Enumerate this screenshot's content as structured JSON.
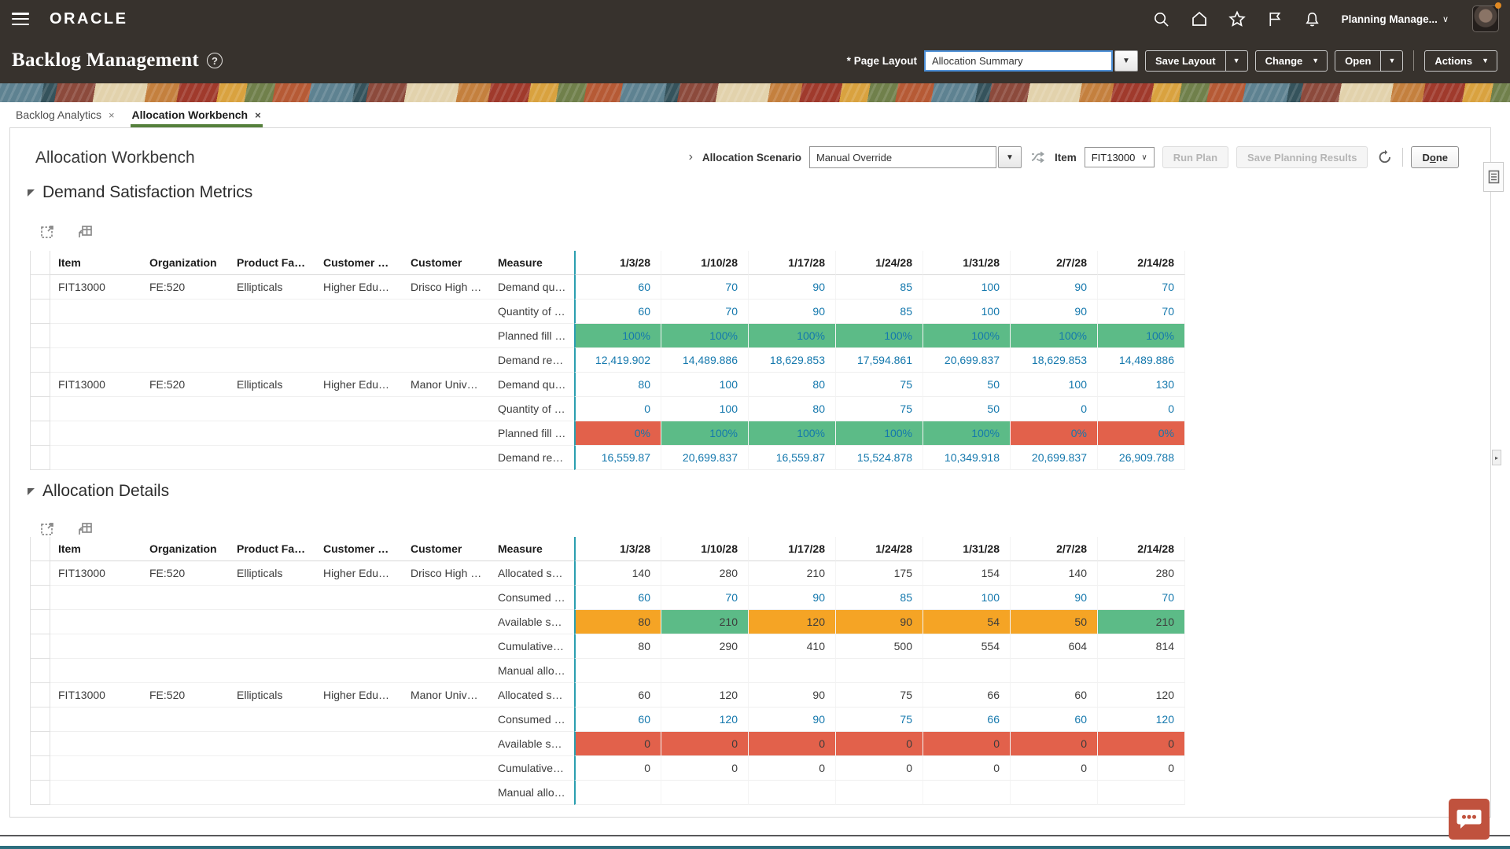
{
  "glyphs": {
    "caret_down": "▼",
    "chevron_down": "∨",
    "close": "×",
    "help": "?",
    "back_chevron": "›",
    "splitter_arrow": "▸"
  },
  "colors": {
    "header_bg": "#37322D",
    "link": "#1478AD",
    "green_cell": "#5CBB87",
    "red_cell": "#E2614B",
    "orange_cell": "#F5A425",
    "tab_underline": "#55803C",
    "measure_divider": "#2B9FB0",
    "chat_button": "#C0523E"
  },
  "topbar": {
    "brand": "ORACLE",
    "user_menu": "Planning Manage..."
  },
  "page_header": {
    "required_marker": "*",
    "page_layout_label": "Page Layout",
    "page_layout_value": "Allocation Summary",
    "title": "Backlog Management",
    "buttons": {
      "save_layout": "Save Layout",
      "change": "Change",
      "open": "Open",
      "actions": "Actions"
    }
  },
  "tabs": [
    {
      "label": "Backlog Analytics",
      "active": false
    },
    {
      "label": "Allocation Workbench",
      "active": true
    }
  ],
  "workbench": {
    "title": "Allocation Workbench",
    "scenario_label": "Allocation Scenario",
    "scenario_value": "Manual Override",
    "item_label": "Item",
    "item_value": "FIT13000",
    "run_plan": "Run Plan",
    "save_planning_results": "Save Planning Results",
    "done_prefix": "D",
    "done_accesskey": "o",
    "done_suffix": "ne"
  },
  "table": {
    "columns": [
      "Item",
      "Organization",
      "Product Family",
      "Customer Class",
      "Customer",
      "Measure"
    ],
    "dates": [
      "1/3/28",
      "1/10/28",
      "1/17/28",
      "1/24/28",
      "1/31/28",
      "2/7/28",
      "2/14/28"
    ]
  },
  "sections": [
    {
      "title": "Demand Satisfaction Metrics",
      "rows": [
        {
          "item": "FIT13000",
          "organization": "FE:520",
          "product_family": "Ellipticals",
          "customer_class": "Higher Education",
          "customer": "Drisco High Sch...",
          "measure": "Demand quantity",
          "value_style": "link",
          "values": [
            "60",
            "70",
            "90",
            "85",
            "100",
            "90",
            "70"
          ]
        },
        {
          "measure": "Quantity of dem...",
          "value_style": "link",
          "values": [
            "60",
            "70",
            "90",
            "85",
            "100",
            "90",
            "70"
          ]
        },
        {
          "measure": "Planned fill rate ...",
          "value_style": "link",
          "values": [
            "100%",
            "100%",
            "100%",
            "100%",
            "100%",
            "100%",
            "100%"
          ],
          "cell_bg": [
            "green",
            "green",
            "green",
            "green",
            "green",
            "green",
            "green"
          ]
        },
        {
          "measure": "Demand revenue",
          "value_style": "link",
          "values": [
            "12,419.902",
            "14,489.886",
            "18,629.853",
            "17,594.861",
            "20,699.837",
            "18,629.853",
            "14,489.886"
          ]
        },
        {
          "item": "FIT13000",
          "organization": "FE:520",
          "product_family": "Ellipticals",
          "customer_class": "Higher Education",
          "customer": "Manor University",
          "measure": "Demand quantity",
          "value_style": "link",
          "values": [
            "80",
            "100",
            "80",
            "75",
            "50",
            "100",
            "130"
          ]
        },
        {
          "measure": "Quantity of dem...",
          "value_style": "link",
          "values": [
            "0",
            "100",
            "80",
            "75",
            "50",
            "0",
            "0"
          ]
        },
        {
          "measure": "Planned fill rate ...",
          "value_style": "link",
          "values": [
            "0%",
            "100%",
            "100%",
            "100%",
            "100%",
            "0%",
            "0%"
          ],
          "cell_bg": [
            "red",
            "green",
            "green",
            "green",
            "green",
            "red",
            "red"
          ]
        },
        {
          "measure": "Demand revenue",
          "value_style": "link",
          "values": [
            "16,559.87",
            "20,699.837",
            "16,559.87",
            "15,524.878",
            "10,349.918",
            "20,699.837",
            "26,909.788"
          ]
        }
      ]
    },
    {
      "title": "Allocation Details",
      "rows": [
        {
          "item": "FIT13000",
          "organization": "FE:520",
          "product_family": "Ellipticals",
          "customer_class": "Higher Education",
          "customer": "Drisco High Sch...",
          "measure": "Allocated supply",
          "value_style": "plain",
          "values": [
            "140",
            "280",
            "210",
            "175",
            "154",
            "140",
            "280"
          ]
        },
        {
          "measure": "Consumed supply",
          "value_style": "link",
          "values": [
            "60",
            "70",
            "90",
            "85",
            "100",
            "90",
            "70"
          ]
        },
        {
          "measure": "Available supply",
          "value_style": "plain",
          "values": [
            "80",
            "210",
            "120",
            "90",
            "54",
            "50",
            "210"
          ],
          "cell_bg": [
            "orange",
            "green",
            "orange",
            "orange",
            "orange",
            "orange",
            "green"
          ]
        },
        {
          "measure": "Cumulative avail...",
          "value_style": "plain",
          "values": [
            "80",
            "290",
            "410",
            "500",
            "554",
            "604",
            "814"
          ]
        },
        {
          "measure": "Manual allocation",
          "value_style": "plain",
          "values": [
            "",
            "",
            "",
            "",
            "",
            "",
            ""
          ]
        },
        {
          "item": "FIT13000",
          "organization": "FE:520",
          "product_family": "Ellipticals",
          "customer_class": "Higher Education",
          "customer": "Manor University",
          "measure": "Allocated supply",
          "value_style": "plain",
          "values": [
            "60",
            "120",
            "90",
            "75",
            "66",
            "60",
            "120"
          ]
        },
        {
          "measure": "Consumed supply",
          "value_style": "link",
          "values": [
            "60",
            "120",
            "90",
            "75",
            "66",
            "60",
            "120"
          ]
        },
        {
          "measure": "Available supply",
          "value_style": "plain",
          "values": [
            "0",
            "0",
            "0",
            "0",
            "0",
            "0",
            "0"
          ],
          "cell_bg": [
            "red",
            "red",
            "red",
            "red",
            "red",
            "red",
            "red"
          ]
        },
        {
          "measure": "Cumulative avail...",
          "value_style": "plain",
          "values": [
            "0",
            "0",
            "0",
            "0",
            "0",
            "0",
            "0"
          ]
        },
        {
          "measure": "Manual allocation",
          "value_style": "plain",
          "values": [
            "",
            "",
            "",
            "",
            "",
            "",
            ""
          ]
        }
      ]
    }
  ]
}
